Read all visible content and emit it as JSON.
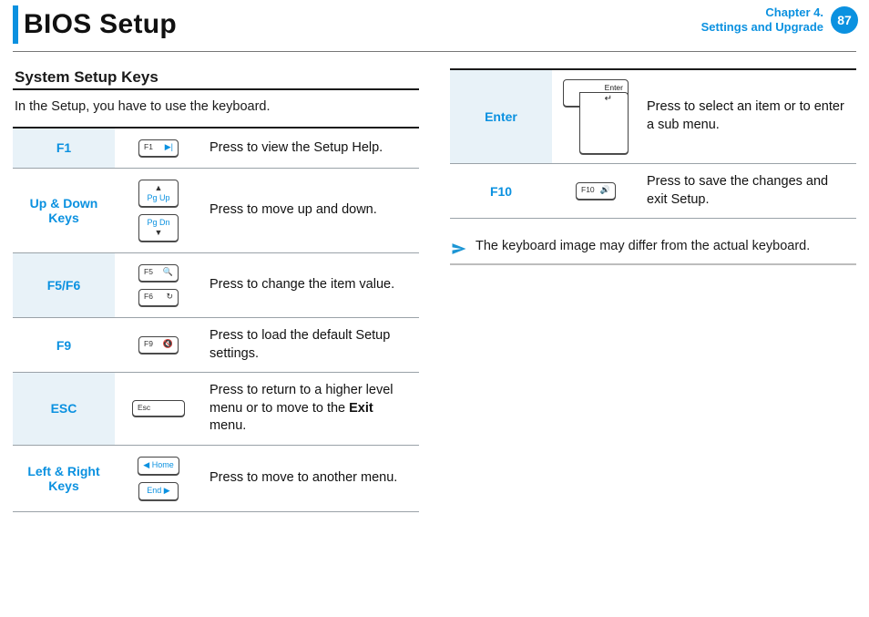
{
  "header": {
    "title": "BIOS Setup",
    "chapter_line1": "Chapter 4.",
    "chapter_line2": "Settings and Upgrade",
    "page_number": "87"
  },
  "section": {
    "heading": "System Setup Keys",
    "intro": "In the Setup, you have to use the keyboard."
  },
  "rows_left": [
    {
      "name": "F1",
      "desc": "Press to view the Setup Help.",
      "keys": [
        "f1"
      ]
    },
    {
      "name": "Up & Down Keys",
      "desc": "Press to move up and down.",
      "keys": [
        "pgup",
        "pgdn"
      ]
    },
    {
      "name": "F5/F6",
      "desc": "Press to change the item value.",
      "keys": [
        "f5",
        "f6"
      ]
    },
    {
      "name": "F9",
      "desc": "Press to load the default Setup settings.",
      "keys": [
        "f9"
      ]
    },
    {
      "name": "ESC",
      "desc_pre": "Press to return to a higher level menu or to move to the ",
      "exit": "Exit",
      "desc_post": " menu.",
      "keys": [
        "esc"
      ]
    },
    {
      "name": "Left & Right Keys",
      "desc": "Press to move to another menu.",
      "keys": [
        "home",
        "end"
      ]
    }
  ],
  "rows_right": [
    {
      "name": "Enter",
      "desc": "Press to select an item or to enter a sub menu.",
      "keys": [
        "enter"
      ]
    },
    {
      "name": "F10",
      "desc": "Press to save the changes and exit Setup.",
      "keys": [
        "f10"
      ]
    }
  ],
  "keylabels": {
    "f1": {
      "label": "F1",
      "glyph": "▶|"
    },
    "pgup": {
      "label": "",
      "mid": "Pg Up",
      "arrow_top": "▲"
    },
    "pgdn": {
      "label": "",
      "mid": "Pg Dn",
      "arrow_bot": "▼"
    },
    "f5": {
      "label": "F5",
      "glyph": "🔍"
    },
    "f6": {
      "label": "F6",
      "glyph": "↻"
    },
    "f9": {
      "label": "F9",
      "glyph": "🔇"
    },
    "esc": {
      "label": "Esc"
    },
    "home": {
      "mid": "Home",
      "arrow_left": "◀"
    },
    "end": {
      "mid": "End",
      "arrow_right": "▶"
    },
    "enter": {
      "label": "Enter",
      "glyph": "↵"
    },
    "f10": {
      "label": "F10",
      "glyph": "🔊"
    }
  },
  "note": "The keyboard image may differ from the actual keyboard."
}
